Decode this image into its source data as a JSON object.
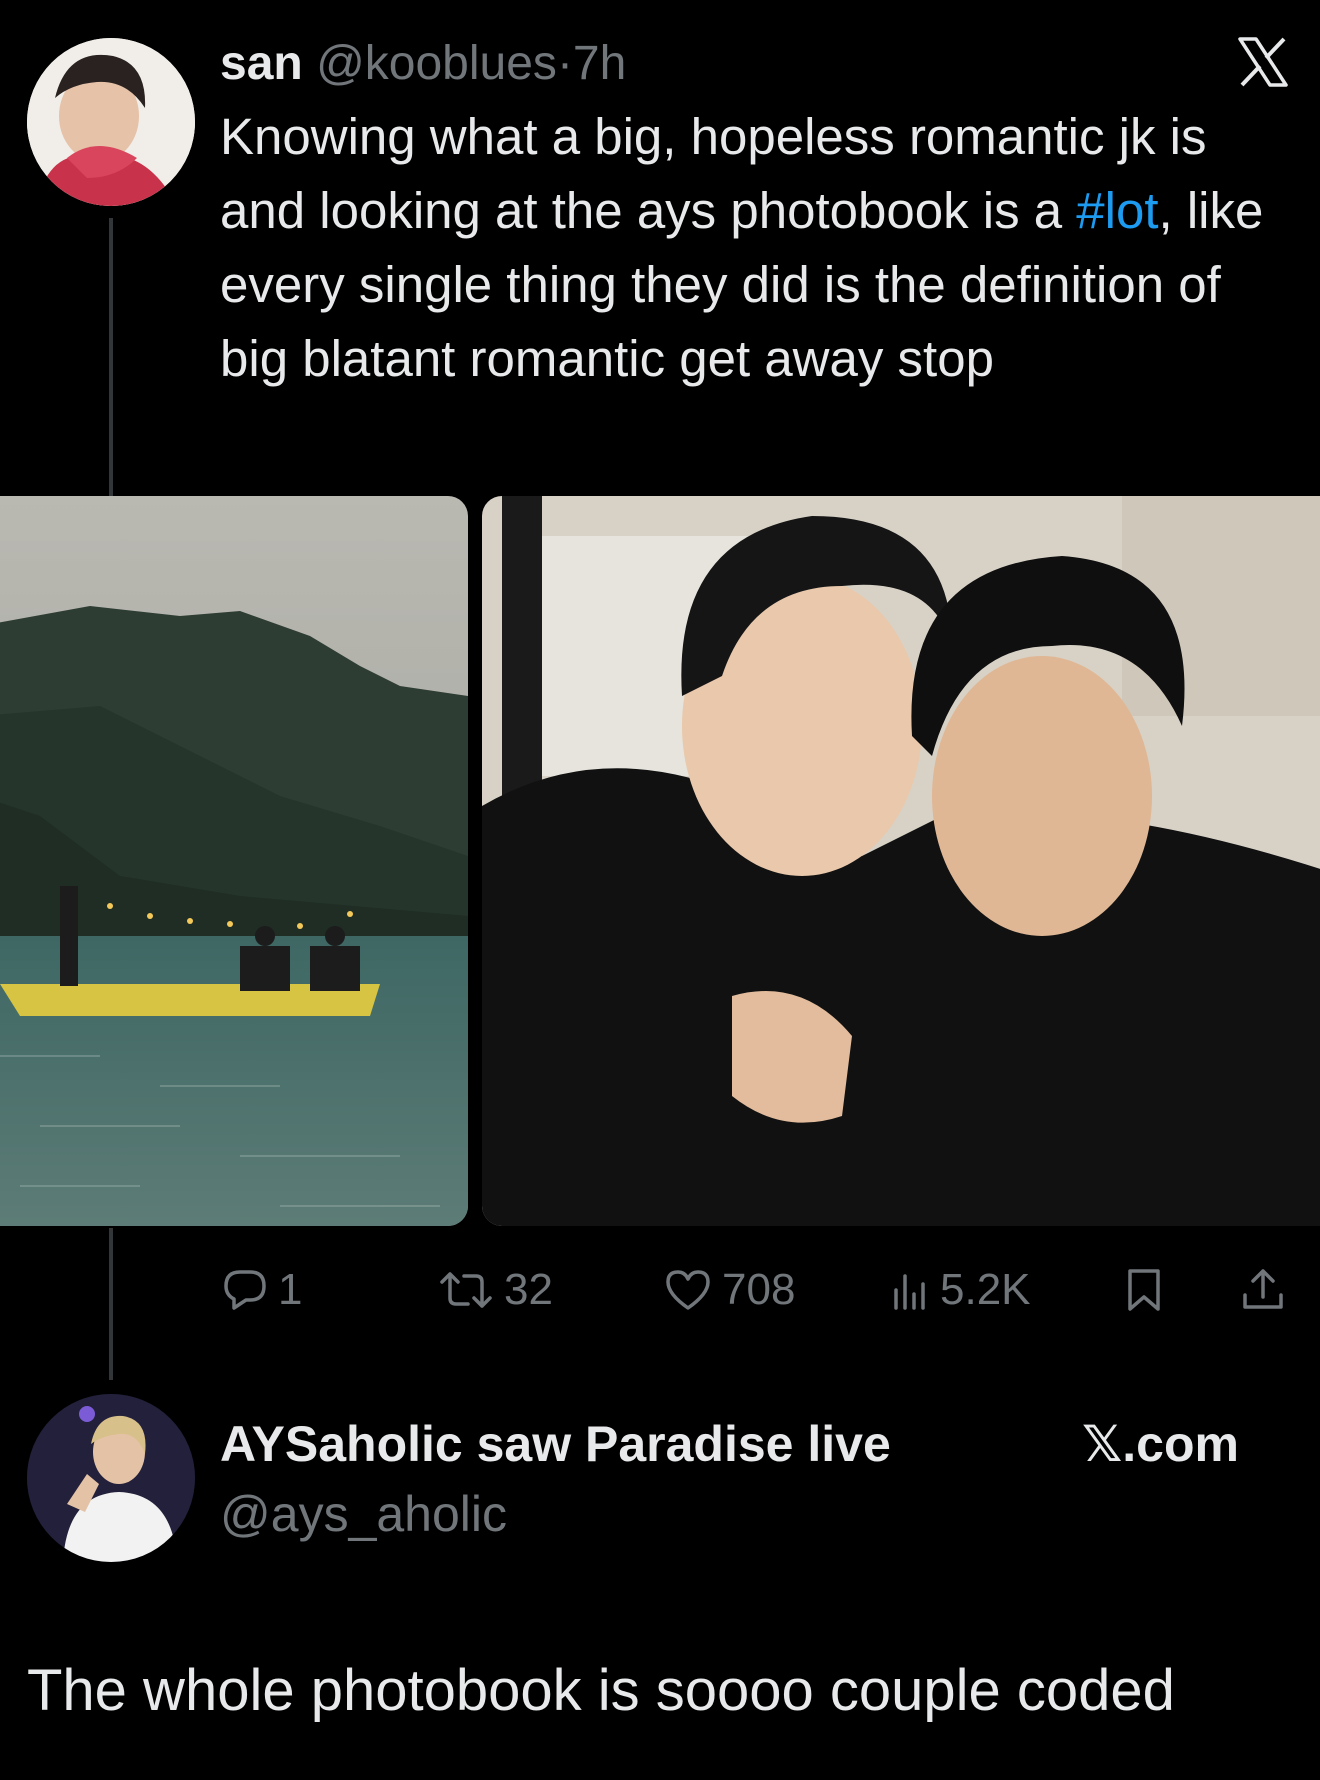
{
  "tweet": {
    "display_name": "san",
    "handle": "@kooblues",
    "separator": "·",
    "time": "7h",
    "text_before_hashtag": "Knowing what a big, hopeless romantic jk is and looking at the ays photobook is a",
    "hashtag": "#lot",
    "text_after_hashtag": ", like every single thing they did is the definition of big blatant romantic get away stop",
    "stats": {
      "replies": "1",
      "retweets": "32",
      "likes": "708",
      "views": "5.2K"
    }
  },
  "reply": {
    "display_name": "AYSaholic saw Paradise live",
    "handle": "@ays_aholic",
    "brand": "𝕏.com",
    "text": "The whole photobook is soooo couple coded"
  },
  "icons": {
    "platform": "x-logo-icon",
    "reply": "reply-icon",
    "retweet": "retweet-icon",
    "like": "heart-icon",
    "views": "views-icon",
    "bookmark": "bookmark-icon",
    "share": "share-icon"
  },
  "colors": {
    "background": "#000000",
    "text": "#e7e9ea",
    "muted": "#71767b",
    "link": "#1d9bf0"
  }
}
